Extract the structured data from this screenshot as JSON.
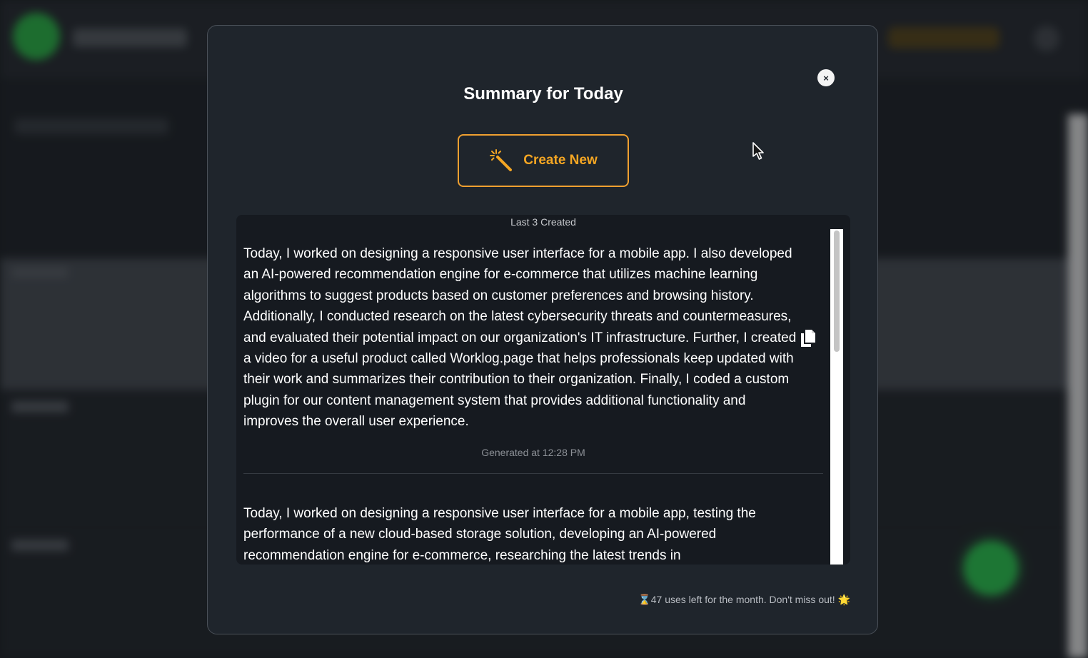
{
  "modal": {
    "title": "Summary for Today",
    "close_glyph": "×",
    "create_label": "Create New",
    "panel_caption": "Last 3 Created",
    "entries": [
      {
        "text": "Today, I worked on designing a responsive user interface for a mobile app. I also developed an AI-powered recommendation engine for e-commerce that utilizes machine learning algorithms to suggest products based on customer preferences and browsing history. Additionally, I conducted research on the latest cybersecurity threats and countermeasures, and evaluated their potential impact on our organization's IT infrastructure. Further, I created a video for a useful product called Worklog.page that helps professionals keep updated with their work and summarizes their contribution to their organization. Finally, I coded a custom plugin for our content management system that provides additional functionality and improves the overall user experience.",
        "generated": "Generated at 12:28 PM"
      },
      {
        "text": "Today, I worked on designing a responsive user interface for a mobile app, testing the performance of a new cloud-based storage solution, developing an AI-powered recommendation engine for e-commerce, researching the latest trends in"
      }
    ],
    "uses_left": "⌛47 uses left for the month. Don't miss out! 🌟"
  },
  "icons": {
    "close": "close-icon",
    "create": "magic-wand-icon",
    "copy": "copy-icon"
  },
  "colors": {
    "accent": "#f5a623",
    "modal_bg": "#1f252c",
    "panel_bg": "#161a20",
    "brand_green": "#2fce55"
  }
}
